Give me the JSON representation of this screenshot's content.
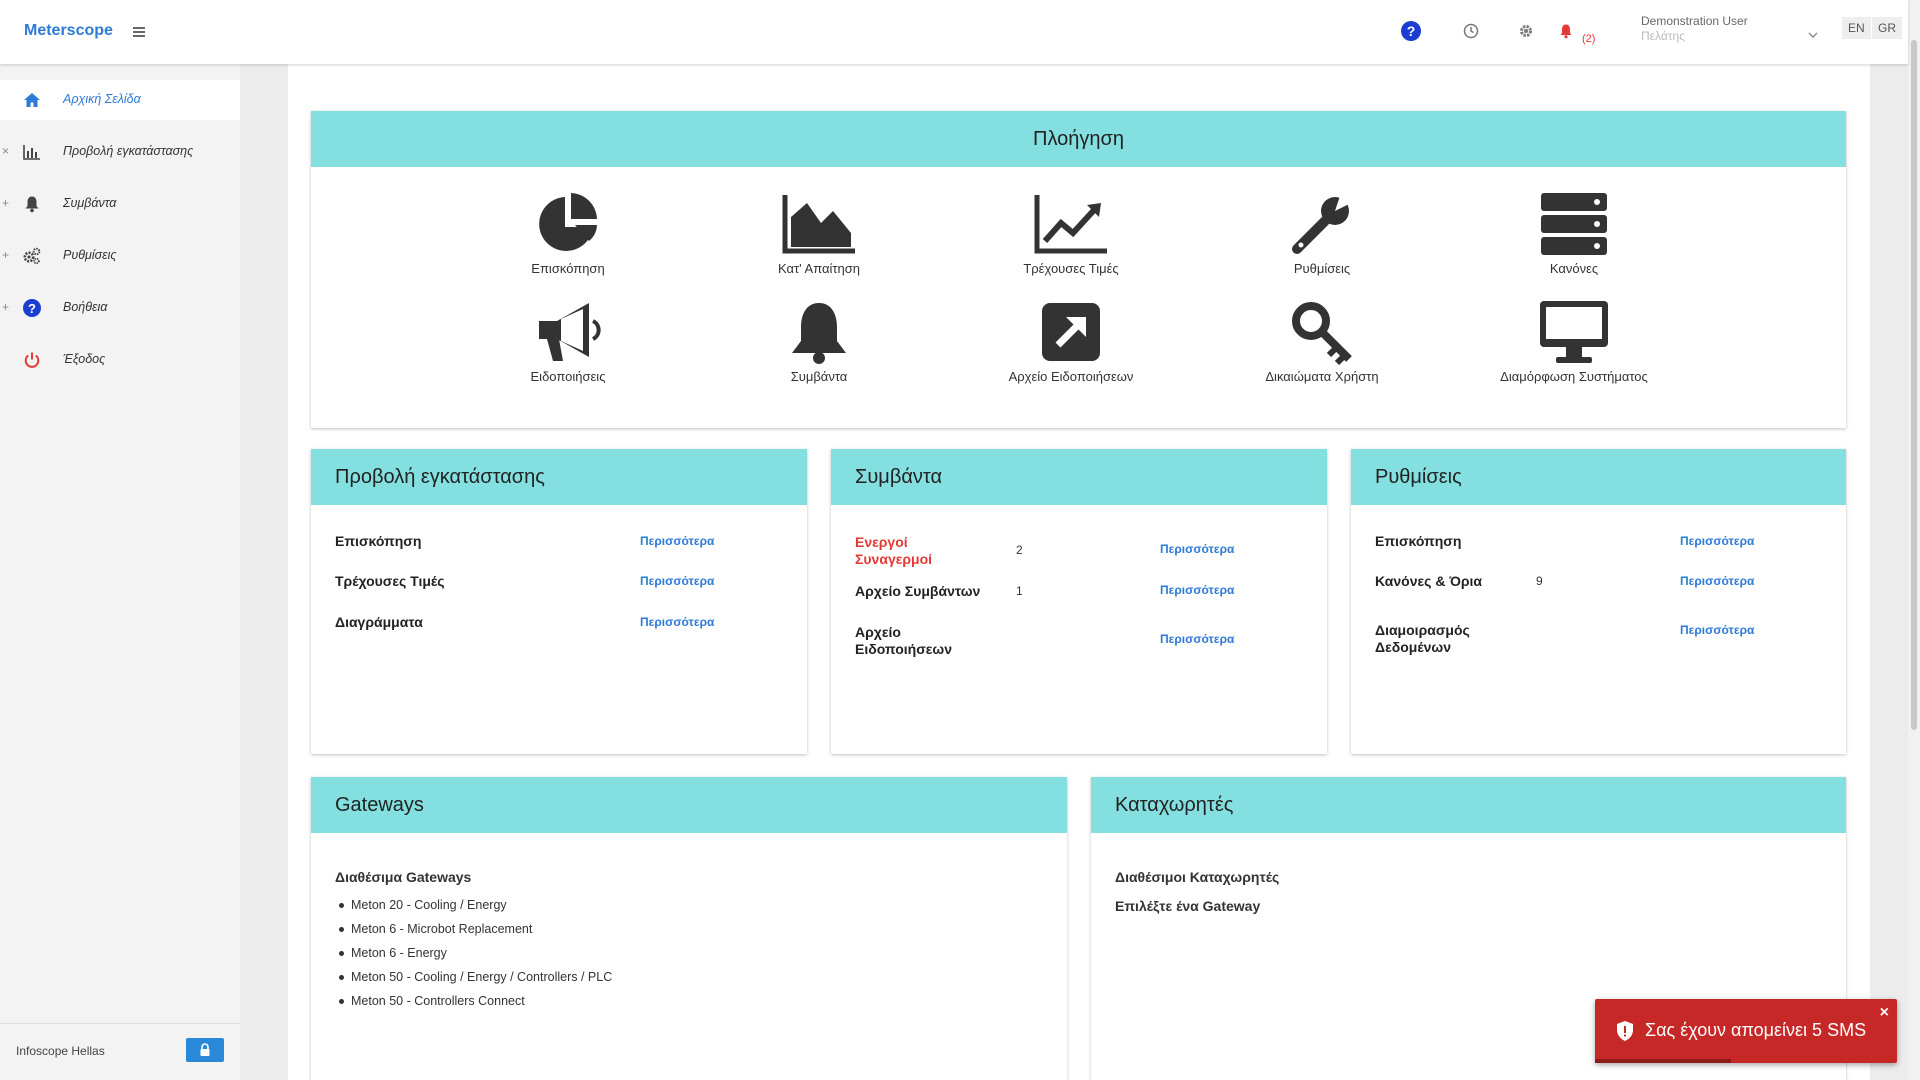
{
  "app": {
    "brand": "Meterscope"
  },
  "topbar": {
    "notifications_count": "(2)",
    "user_name": "Demonstration User",
    "user_role": "Πελάτης",
    "lang_en": "EN",
    "lang_gr": "GR"
  },
  "sidebar": {
    "items": [
      {
        "label": "Αρχική Σελίδα",
        "icon": "home-icon",
        "expander": ""
      },
      {
        "label": "Προβολή εγκατάστασης",
        "icon": "bar-chart-icon",
        "expander": "×"
      },
      {
        "label": "Συμβάντα",
        "icon": "bell-icon",
        "expander": "+"
      },
      {
        "label": "Ρυθμίσεις",
        "icon": "gears-icon",
        "expander": "+"
      },
      {
        "label": "Βοήθεια",
        "icon": "question-icon",
        "expander": "+"
      },
      {
        "label": "Έξοδος",
        "icon": "power-icon",
        "expander": ""
      }
    ],
    "footer_company": "Infoscope Hellas"
  },
  "navigation": {
    "title": "Πλοήγηση",
    "items": [
      {
        "label": "Επισκόπηση",
        "icon": "pie-chart-icon"
      },
      {
        "label": "Κατ' Απαίτηση",
        "icon": "area-chart-icon"
      },
      {
        "label": "Τρέχουσες Τιμές",
        "icon": "line-chart-icon"
      },
      {
        "label": "Ρυθμίσεις",
        "icon": "wrench-icon"
      },
      {
        "label": "Κανόνες",
        "icon": "server-icon"
      },
      {
        "label": "Ειδοποιήσεις",
        "icon": "megaphone-icon"
      },
      {
        "label": "Συμβάντα",
        "icon": "bell-icon"
      },
      {
        "label": "Αρχείο Ειδοποιήσεων",
        "icon": "external-link-icon"
      },
      {
        "label": "Δικαιώματα Χρήστη",
        "icon": "key-icon"
      },
      {
        "label": "Διαμόρφωση Συστήματος",
        "icon": "desktop-icon"
      }
    ]
  },
  "installation_panel": {
    "title": "Προβολή εγκατάστασης",
    "rows": [
      {
        "label": "Επισκόπηση",
        "link": "Περισσότερα"
      },
      {
        "label": "Τρέχουσες Τιμές",
        "link": "Περισσότερα"
      },
      {
        "label": "Διαγράμματα",
        "link": "Περισσότερα"
      }
    ]
  },
  "events_panel": {
    "title": "Συμβάντα",
    "rows": [
      {
        "label": "Ενεργοί Συναγερμοί",
        "count": "2",
        "link": "Περισσότερα"
      },
      {
        "label": "Αρχείο Συμβάντων",
        "count": "1",
        "link": "Περισσότερα"
      },
      {
        "label": "Αρχείο Ειδοποιήσεων",
        "count": "",
        "link": "Περισσότερα"
      }
    ]
  },
  "settings_panel": {
    "title": "Ρυθμίσεις",
    "rows": [
      {
        "label": "Επισκόπηση",
        "count": "",
        "link": "Περισσότερα"
      },
      {
        "label": "Κανόνες & Όρια",
        "count": "9",
        "link": "Περισσότερα"
      },
      {
        "label": "Διαμοιρασμός Δεδομένων",
        "count": "",
        "link": "Περισσότερα"
      }
    ]
  },
  "gateways_panel": {
    "title": "Gateways",
    "subtitle": "Διαθέσιμα Gateways",
    "items": [
      "Meton 20 - Cooling / Energy",
      "Meton 6 - Microbot Replacement",
      "Meton 6 - Energy",
      "Meton 50 - Cooling / Energy / Controllers / PLC",
      "Meton 50 - Controllers Connect"
    ]
  },
  "loggers_panel": {
    "title": "Καταχωρητές",
    "subtitle": "Διαθέσιμοι Καταχωρητές",
    "hint": "Επιλέξτε ένα Gateway"
  },
  "toast": {
    "message": "Σας έχουν απομείνει 5 SMS",
    "close": "×"
  },
  "colors": {
    "accent": "#2e7ad6",
    "panel_header": "#84e0e0",
    "alarm_red": "#e53935",
    "toast_bg": "#c62828"
  }
}
